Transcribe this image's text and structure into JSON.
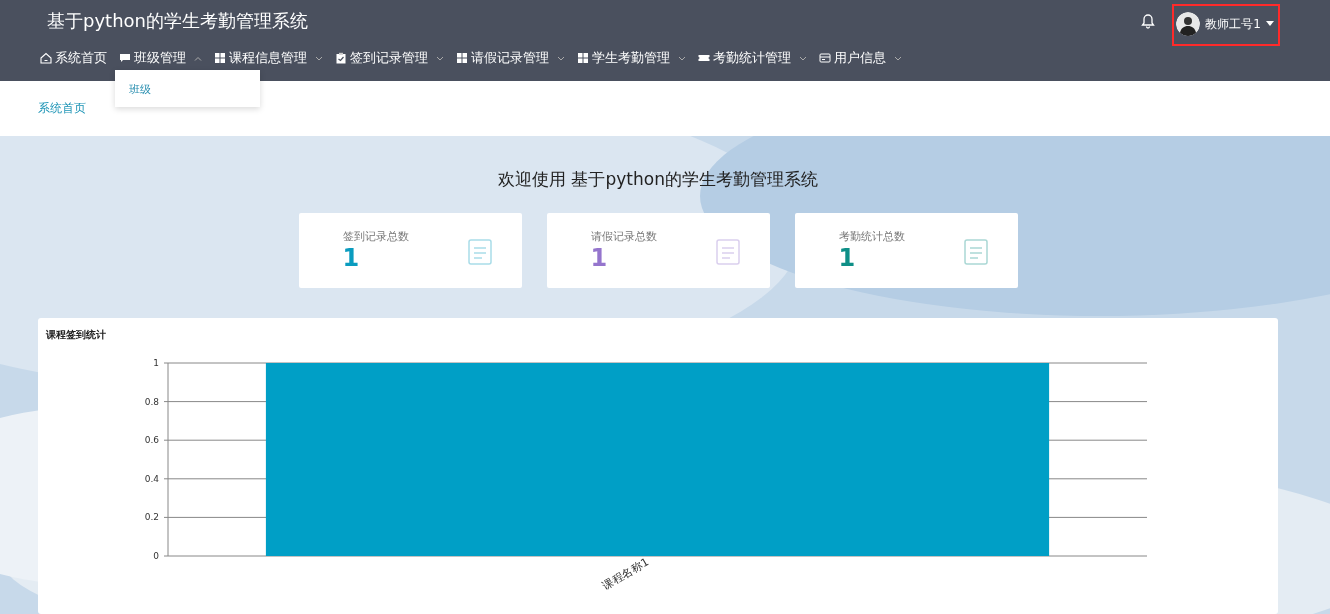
{
  "header": {
    "title": "基于python的学生考勤管理系统",
    "user": {
      "name": "教师工号1"
    }
  },
  "nav": [
    {
      "kind": "link",
      "label": "系统首页"
    },
    {
      "kind": "menu",
      "label": "班级管理",
      "expanded": true,
      "children": [
        {
          "label": "班级"
        }
      ]
    },
    {
      "kind": "menu",
      "label": "课程信息管理",
      "expanded": false
    },
    {
      "kind": "menu",
      "label": "签到记录管理",
      "expanded": false
    },
    {
      "kind": "menu",
      "label": "请假记录管理",
      "expanded": false
    },
    {
      "kind": "menu",
      "label": "学生考勤管理",
      "expanded": false
    },
    {
      "kind": "menu",
      "label": "考勤统计管理",
      "expanded": false
    },
    {
      "kind": "menu",
      "label": "用户信息",
      "expanded": false
    }
  ],
  "breadcrumb": "系统首页",
  "welcome": "欢迎使用 基于python的学生考勤管理系统",
  "stats": [
    {
      "label": "签到记录总数",
      "value": "1",
      "color": "#0a9cbf"
    },
    {
      "label": "请假记录总数",
      "value": "1",
      "color": "#9575cd"
    },
    {
      "label": "考勤统计总数",
      "value": "1",
      "color": "#0e8f87"
    }
  ],
  "chart_panel": {
    "title": "课程签到统计",
    "chart_data": {
      "type": "bar",
      "categories": [
        "课程名称1"
      ],
      "series": [
        {
          "color": "#009fc6",
          "values": [
            1
          ]
        }
      ],
      "grid": true,
      "ylim": [
        0,
        1
      ],
      "yticks": [
        0,
        0.2,
        0.4,
        0.6,
        0.8,
        1
      ]
    }
  }
}
